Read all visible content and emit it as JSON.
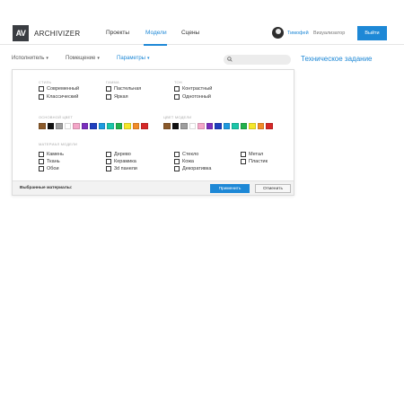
{
  "header": {
    "logo_mark": "AV",
    "logo_text": "ARCHIVIZER",
    "nav": [
      "Проекты",
      "Модели",
      "Сцены"
    ],
    "active_nav": "Модели",
    "user_name": "Тимофей",
    "user_role": "Визуализатор",
    "logout_label": "Выйти"
  },
  "toolbar": {
    "filters": [
      "Исполнитель",
      "Помещение",
      "Параметры"
    ],
    "active_filter": "Параметры",
    "search_placeholder": "",
    "spec_link": "Техническое задание"
  },
  "panel": {
    "style": {
      "title": "стиль",
      "options": [
        "Современный",
        "Классический"
      ]
    },
    "color_range": {
      "title": "гамма",
      "options": [
        "Пастельная",
        "Яркая"
      ]
    },
    "tone": {
      "title": "тон",
      "options": [
        "Контрастный",
        "Однотонный"
      ]
    },
    "main_color": {
      "title": "основной цвет",
      "colors": [
        "#8b5a2b",
        "#111111",
        "#9e9e9e",
        "#ffffff",
        "#f4a6c8",
        "#7b2fbe",
        "#1f3fbf",
        "#1e9be0",
        "#1bc6a8",
        "#22b14c",
        "#f5e72a",
        "#f28c28",
        "#d62828"
      ]
    },
    "model_color": {
      "title": "цвет модели",
      "colors": [
        "#8b5a2b",
        "#111111",
        "#9e9e9e",
        "#ffffff",
        "#f4a6c8",
        "#7b2fbe",
        "#1f3fbf",
        "#1e9be0",
        "#1bc6a8",
        "#22b14c",
        "#f5e72a",
        "#f28c28",
        "#d62828"
      ]
    },
    "material": {
      "title": "материал модели",
      "col1": [
        "Камень",
        "Ткань",
        "Обои"
      ],
      "col2": [
        "Дерево",
        "Керамика",
        "3d панели"
      ],
      "col3": [
        "Стекло",
        "Кожа",
        "Декоративка"
      ],
      "col4": [
        "Метал",
        "Пластик"
      ]
    },
    "footer": {
      "selected_label": "Выбранные материалы:",
      "apply_label": "Применить",
      "cancel_label": "Отменить"
    }
  }
}
